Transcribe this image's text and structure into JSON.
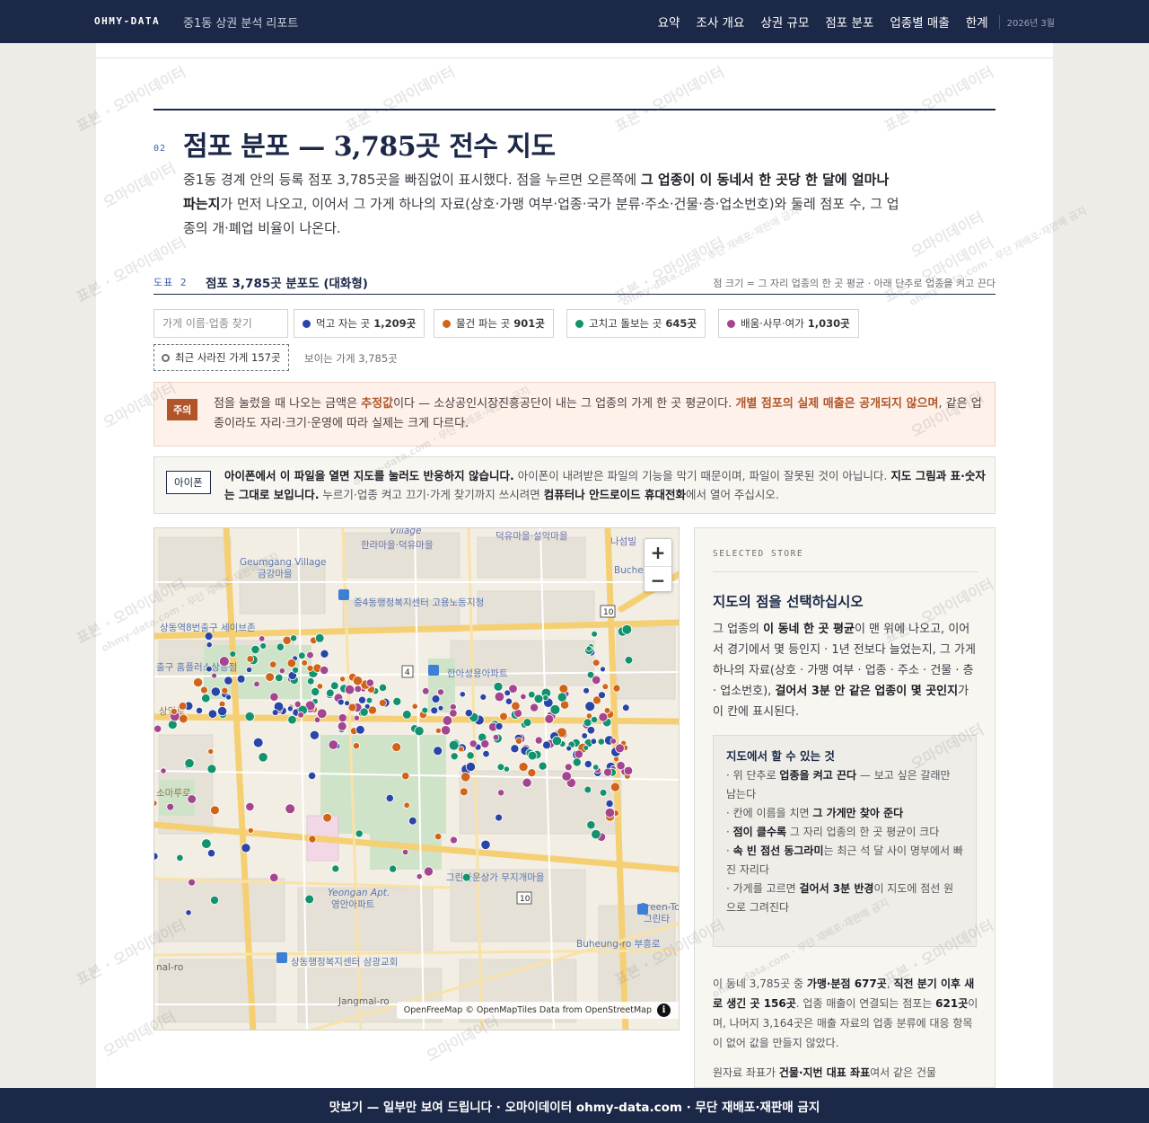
{
  "topbar": {
    "brand": "OHMY-DATA",
    "subtitle": "중1동 상권 분석 리포트",
    "nav": [
      "요약",
      "조사 개요",
      "상권 규모",
      "점포 분포",
      "업종별 매출",
      "한계"
    ],
    "date": "2026년 3월"
  },
  "section": {
    "number": "02",
    "title": "점포 분포 — 3,785곳 전수 지도",
    "intro": {
      "p1": "중1동 경계 안의 등록 점포 3,785곳을 빠짐없이 표시했다. 점을 누르면 오른쪽에 ",
      "b1": "그 업종이 이 동네서 한 곳당 한 달에 얼마나 파는지",
      "p2": "가 먼저 나오고, 이어서 그 가게 하나의 자료(상호·가맹 여부·업종·국가 분류·주소·건물·층·업소번호)와 둘레 점포 수, 그 업종의 개·폐업 비율이 나온다."
    }
  },
  "figure": {
    "label": "도표 2",
    "title": "점포 3,785곳 분포도 (대화형)",
    "note": "점 크기 = 그 자리 업종의 한 곳 평균 · 아래 단추로 업종을 켜고 끈다"
  },
  "filters": {
    "search_placeholder": "가게 이름·업종 찾기",
    "chips": [
      {
        "label": "먹고 자는 곳",
        "count": "1,209곳",
        "color": "#2a45a8"
      },
      {
        "label": "물건 파는 곳",
        "count": "901곳",
        "color": "#d2641a"
      },
      {
        "label": "고치고 돌보는 곳",
        "count": "645곳",
        "color": "#13926e"
      },
      {
        "label": "배움·사무·여가",
        "count": "1,030곳",
        "color": "#a3458f"
      }
    ],
    "closed_label": "최근 사라진 가게 157곳",
    "visible_count": "보이는 가게 3,785곳"
  },
  "notice": {
    "tag": "주의",
    "t1": "점을 눌렀을 때 나오는 금액은 ",
    "b1": "추정값",
    "t2": "이다 — 소상공인시장진흥공단이 내는 그 업종의 가게 한 곳 평균이다. ",
    "b2": "개별 점포의 실제 매출은 공개되지 않으며",
    "t3": ", 같은 업종이라도 자리·크기·운영에 따라 실제는 크게 다르다."
  },
  "iphone": {
    "tag": "아이폰",
    "b1": "아이폰에서 이 파일을 열면 지도를 눌러도 반응하지 않습니다.",
    "t1": " 아이폰이 내려받은 파일의 기능을 막기 때문이며, 파일이 잘못된 것이 아닙니다. ",
    "b2": "지도 그림과 표·숫자는 그대로 보입니다.",
    "t2": " 누르기·업종 켜고 끄기·가게 찾기까지 쓰시려면 ",
    "b3": "컴퓨터나 안드로이드 휴대전화",
    "t3": "에서 열어 주십시오."
  },
  "map": {
    "zoom_in": "+",
    "zoom_out": "−",
    "attribution": "OpenFreeMap © OpenMapTiles Data from OpenStreetMap",
    "info_icon": "i",
    "labels": {
      "village_en": "Village",
      "hanra": "한라마을·덕유마을",
      "deogyu": "덕유마을·설악마을",
      "nasum": "나섬빌",
      "geumgang_en": "Geumgang Village",
      "geumgang": "금강마을",
      "bucheon_en": "Buche",
      "junggu4": "중4동행정복지센터 고용노동지청",
      "sangdong8": "상동역8번출구 세이브존",
      "exit": "출구 홈플러스상동점",
      "route10a": "10",
      "route4": "4",
      "hanil": "한아성용아파트",
      "route10b": "10",
      "greentown": "그린타운상가 무지개마을",
      "yeongan_en": "Yeongan Apt.",
      "yeongan": "영안아파트",
      "greento": "Green-To",
      "greenta": "그린타",
      "buheung": "Buheung-ro 부흥로",
      "sangdong_center": "상동행정복지센터 삼광교회",
      "jangmal": "Jangmal-ro",
      "somaro": "소마루로",
      "sangil": "상일로",
      "road_left": "nal-ro"
    }
  },
  "panel": {
    "eyebrow": "SELECTED STORE",
    "title": "지도의 점을 선택하십시오",
    "desc": {
      "t1": "그 업종의 ",
      "b1": "이 동네 한 곳 평균",
      "t2": "이 맨 위에 나오고, 이어서 경기에서 몇 등인지 · 1년 전보다 늘었는지, 그 가게 하나의 자료(상호 · 가맹 여부 · 업종 · 주소 · 건물 · 층 · 업소번호), ",
      "b2": "걸어서 3분 안 같은 업종이 몇 곳인지",
      "t3": "가 이 칸에 표시된다."
    },
    "howto": {
      "title": "지도에서 할 수 있는 것",
      "i1a": "· 위 단추로 ",
      "i1b": "업종을 켜고 끈다",
      "i1c": " — 보고 싶은 갈래만 남는다",
      "i2a": "· 칸에 이름을 치면 ",
      "i2b": "그 가게만 찾아 준다",
      "i2c": "",
      "i3a": "· ",
      "i3b": "점이 클수록",
      "i3c": " 그 자리 업종의 한 곳 평균이 크다",
      "i4a": "· ",
      "i4b": "속 빈 점선 동그라미",
      "i4c": "는 최근 석 달 사이 명부에서 빠진 자리다",
      "i5a": "· 가게를 고르면 ",
      "i5b": "걸어서 3분 반경",
      "i5c": "이 지도에 점선 원으로 그려진다"
    },
    "foot": {
      "t1": "이 동네 3,785곳 중 ",
      "b1": "가맹·분점 677곳",
      "t2": ", ",
      "b2": "직전 분기 이후 새로 생긴 곳 156곳",
      "t3": ". 업종 매출이 연결되는 점포는 ",
      "b3": "621곳",
      "t4": "이며, 나머지 3,164곳은 매출 자료의 업종 분류에 대응 항목이 없어 값을 만들지 않았다."
    },
    "foot2": {
      "t1": "원자료 좌표가 ",
      "b1": "건물·지번 대표 좌표",
      "t2": "여서 같은 건물"
    }
  },
  "footer": {
    "text": "맛보기 — 일부만 보여 드립니다 · 오마이데이터 ohmy-data.com · 무단 재배포·재판매 금지"
  },
  "watermarks": {
    "a": "표본 · 오마이데이터",
    "b": "ohmy-data.com · 무단 재배포·재판매 금지",
    "c": "오마이데이터"
  }
}
